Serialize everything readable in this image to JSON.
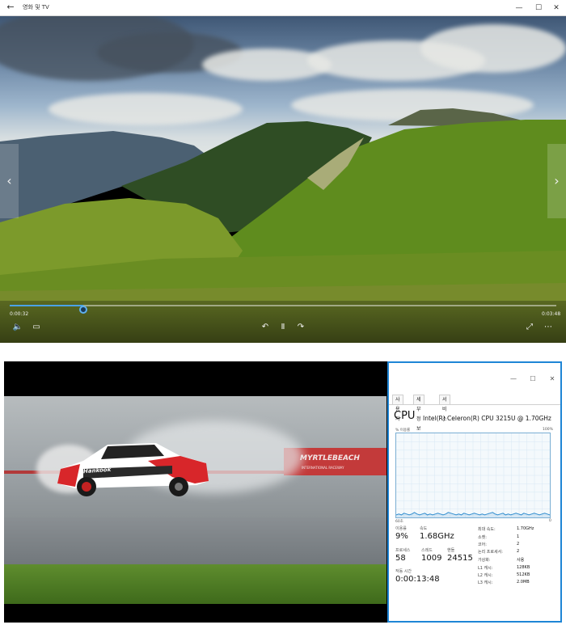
{
  "app1": {
    "title": "영화 및 TV",
    "back_icon": "back-arrow-icon",
    "window_buttons": [
      "—",
      "☐",
      "✕"
    ],
    "player": {
      "current_time": "0:00:32",
      "total_time": "0:03:48",
      "progress": 0.134,
      "prev_icon": "‹",
      "next_icon": "›",
      "volume_icon": "🔈",
      "subtitle_icon": "▭",
      "rewind_icon": "↶",
      "pause_icon": "Ⅱ",
      "forward_icon": "↷",
      "fullscreen_icon": "⤢",
      "more_icon": "⋯"
    }
  },
  "app2": {
    "video": {
      "banner": "MYRTLEBEACH",
      "sponsor": "INTERNATIONAL RACEWAY",
      "car_brand": "Hankook"
    },
    "taskmgr": {
      "window_buttons": [
        "—",
        "☐",
        "✕"
      ],
      "tabs": [
        "사용자",
        "세부 정보",
        "서비스"
      ],
      "cpu_title": "CPU",
      "cpu_model": "Intel(R) Celeron(R) CPU 3215U @ 1.70GHz",
      "graph_label": "% 이용률",
      "graph_max": "100%",
      "graph_time": "60초",
      "graph_min": "0",
      "utilization_label": "이용률",
      "utilization": "9%",
      "speed_label": "속도",
      "speed": "1.68GHz",
      "processes_label": "프로세스",
      "processes": "58",
      "threads_label": "스레드",
      "threads": "1009",
      "handles_label": "핸들",
      "handles": "24515",
      "uptime_label": "작동 시간",
      "uptime": "0:00:13:48",
      "specs": [
        {
          "label": "최대 속도:",
          "value": "1.70GHz"
        },
        {
          "label": "소켓:",
          "value": "1"
        },
        {
          "label": "코어:",
          "value": "2"
        },
        {
          "label": "논리 프로세서:",
          "value": "2"
        },
        {
          "label": "가상화:",
          "value": "사용"
        },
        {
          "label": "L1 캐시:",
          "value": "128KB"
        },
        {
          "label": "L2 캐시:",
          "value": "512KB"
        },
        {
          "label": "L3 캐시:",
          "value": "2.0MB"
        }
      ],
      "graph_series": [
        3,
        4,
        3,
        5,
        4,
        3,
        4,
        6,
        4,
        3,
        4,
        5,
        3,
        4,
        3,
        4,
        5,
        4,
        3,
        4,
        6,
        5,
        4,
        3,
        4,
        3,
        5,
        4,
        3,
        4,
        5,
        4,
        3,
        4,
        3,
        4,
        5,
        6,
        4,
        3,
        4,
        5,
        3,
        4,
        3,
        4,
        5,
        4,
        3,
        5,
        4,
        3,
        4,
        5,
        4,
        3,
        4,
        5,
        4,
        3
      ]
    }
  }
}
